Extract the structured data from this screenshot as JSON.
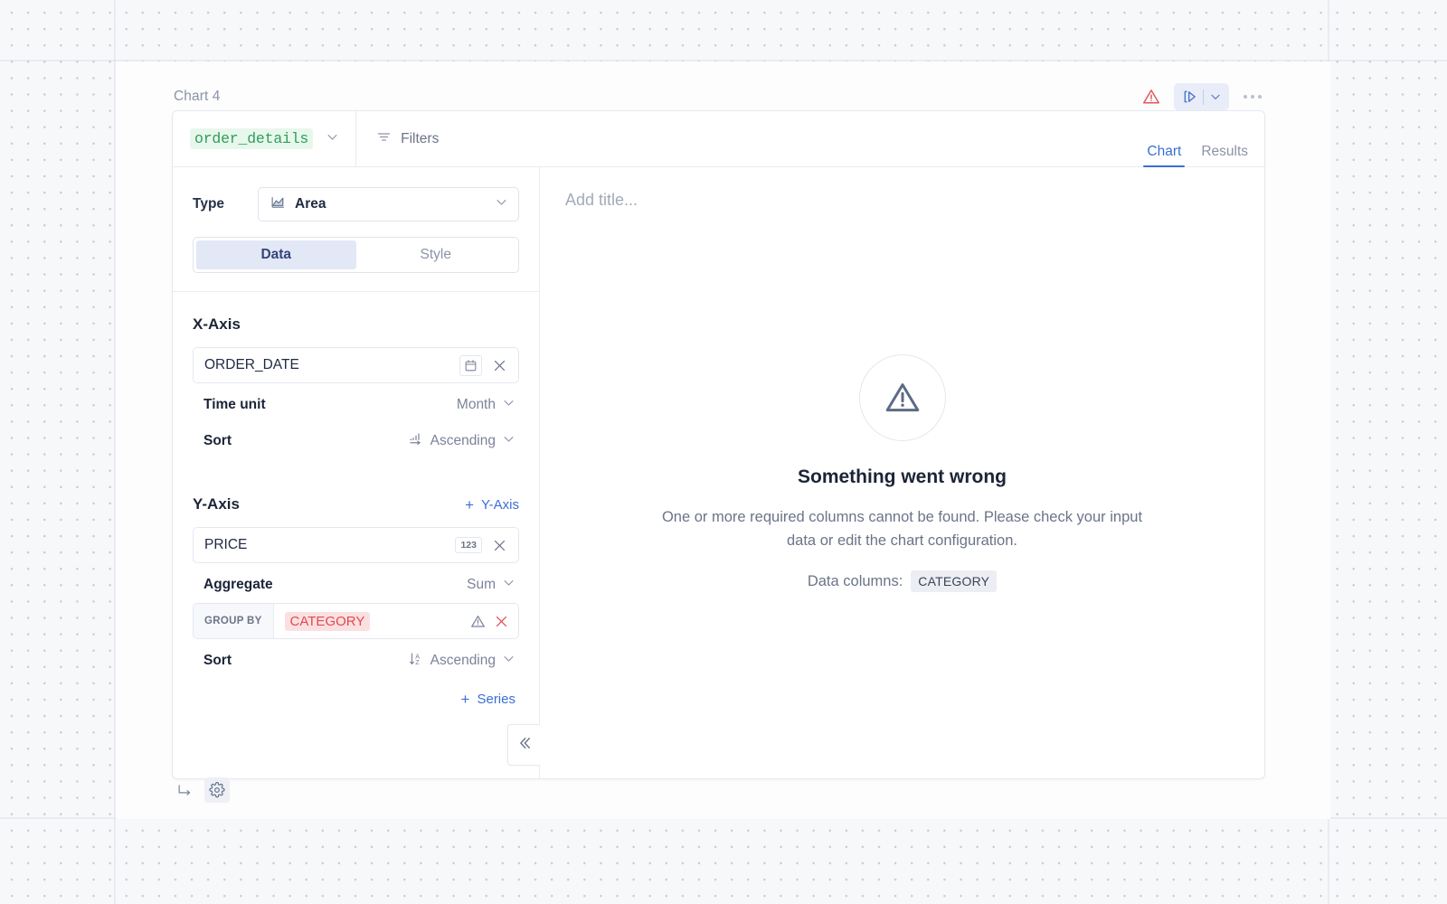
{
  "card": {
    "title": "Chart 4",
    "actions": {
      "warning_icon": "warning-triangle-icon",
      "run_icon": "run-play-icon",
      "run_caret_icon": "chevron-down-icon",
      "more_icon": "kebab-more-icon"
    },
    "footer": {
      "branch_icon": "branch-arrow-icon",
      "settings_icon": "gear-icon"
    }
  },
  "topbar": {
    "dataset": "order_details",
    "dataset_caret_icon": "chevron-down-icon",
    "filters_label": "Filters",
    "filters_icon": "filter-icon",
    "tabs": [
      {
        "label": "Chart",
        "active": true
      },
      {
        "label": "Results",
        "active": false
      }
    ]
  },
  "config": {
    "type_label": "Type",
    "type_value": "Area",
    "type_icon": "area-chart-icon",
    "type_caret_icon": "chevron-down-icon",
    "segments": [
      {
        "label": "Data",
        "active": true
      },
      {
        "label": "Style",
        "active": false
      }
    ],
    "x_axis": {
      "title": "X-Axis",
      "field": "ORDER_DATE",
      "field_type_icon": "calendar-icon",
      "remove_icon": "close-x-icon",
      "options": [
        {
          "label": "Time unit",
          "value": "Month",
          "icon": null
        },
        {
          "label": "Sort",
          "value": "Ascending",
          "icon": "sort-numeric-ascending-icon"
        }
      ]
    },
    "y_axis": {
      "title": "Y-Axis",
      "add_label": "Y-Axis",
      "add_plus": "+",
      "field": "PRICE",
      "field_type_badge": "123",
      "remove_icon": "close-x-icon",
      "aggregate_label": "Aggregate",
      "aggregate_value": "Sum",
      "group_by_label": "GROUP BY",
      "group_by_field": "CATEGORY",
      "group_by_warning_icon": "warning-triangle-icon",
      "group_by_remove_icon": "close-x-icon",
      "sort_label": "Sort",
      "sort_value": "Ascending",
      "sort_icon": "sort-alpha-ascending-icon"
    },
    "add_series_label": "Series",
    "add_series_plus": "+",
    "collapse_icon": "double-chevron-left-icon"
  },
  "preview": {
    "title_placeholder": "Add title...",
    "error_icon": "warning-triangle-icon",
    "error_title": "Something went wrong",
    "error_description": "One or more required columns cannot be found. Please check your input data or edit the chart configuration.",
    "data_columns_label": "Data columns:",
    "data_columns_value": "CATEGORY"
  },
  "colors": {
    "accent": "#3b6fd4",
    "dataset_green": "#2f9e5b",
    "error_red": "#e04a52",
    "warning_red": "#e0565c",
    "muted": "#8b93a7"
  }
}
